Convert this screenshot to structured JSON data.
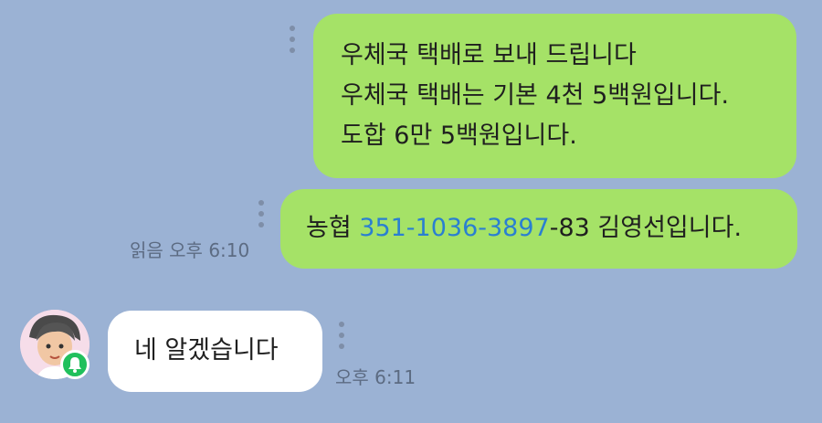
{
  "messages": [
    {
      "lines": [
        "우체국 택배로 보내 드립니다",
        "우체국 택배는 기본 4천 5백원입니다.",
        "도합 6만 5백원입니다."
      ]
    },
    {
      "prefix": "농협 ",
      "account_link": "351-1036-3897",
      "suffix": "-83 김영선입니다.",
      "meta": "읽음 오후 6:10"
    },
    {
      "text": "네 알겠습니다",
      "meta": "오후 6:11"
    }
  ],
  "colors": {
    "background": "#9bb2d4",
    "sent_bubble": "#a5e267",
    "received_bubble": "#ffffff",
    "link": "#2a7fd1",
    "status_badge": "#20c05c"
  },
  "icons": {
    "more_options": "more-vertical-icon",
    "avatar_badge": "bell-icon"
  }
}
